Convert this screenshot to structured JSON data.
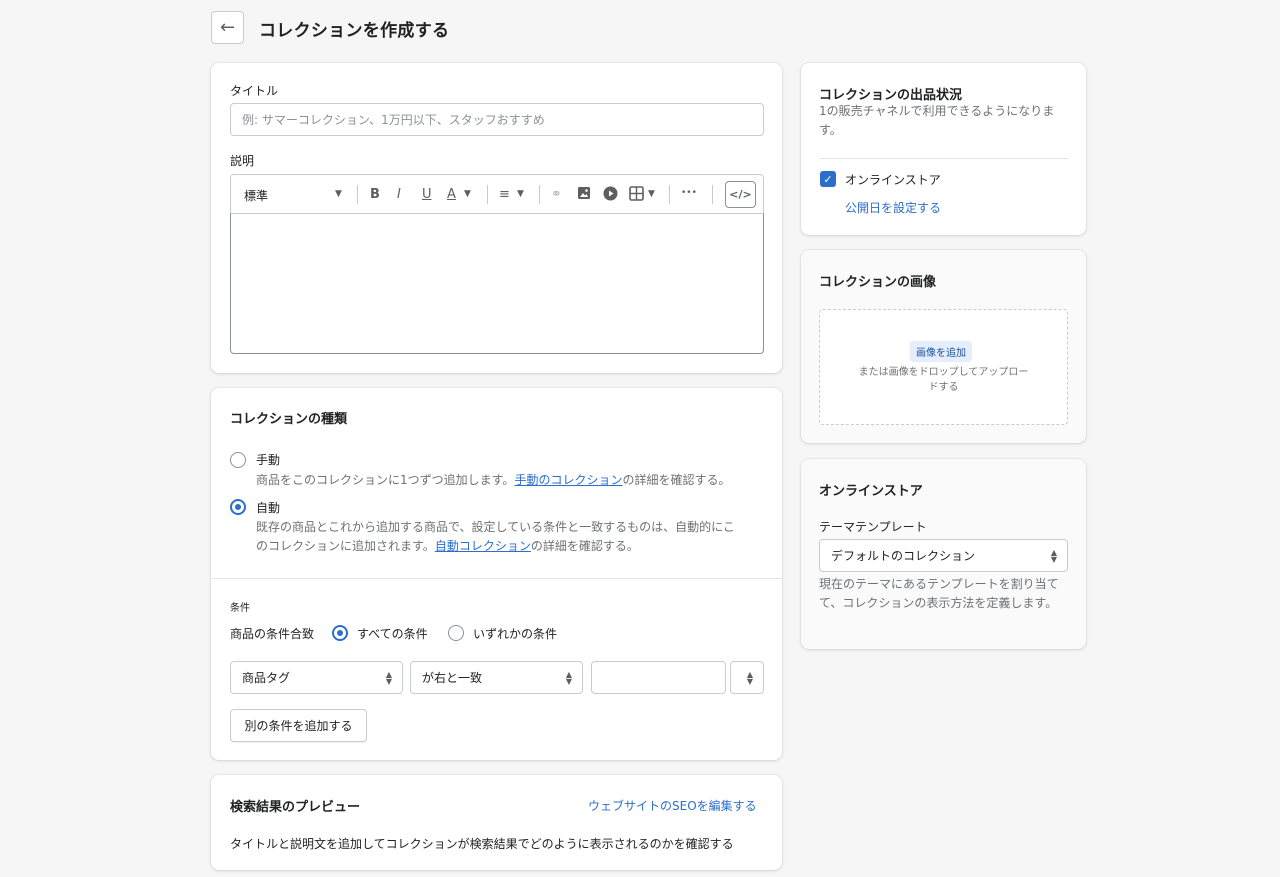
{
  "header": {
    "back_icon": "arrow-left-icon",
    "title": "コレクションを作成する"
  },
  "details": {
    "title_label": "タイトル",
    "title_placeholder": "例: サマーコレクション、1万円以下、スタッフおすすめ",
    "description_label": "説明",
    "toolbar": {
      "format_value": "標準",
      "bold": "B",
      "italic": "I",
      "underline": "U",
      "text_color": "A",
      "align_icon": "align-left-icon",
      "link_icon": "link-icon",
      "image_icon": "image-icon",
      "video_icon": "play-icon",
      "table_icon": "table-icon",
      "more": "•••",
      "code": "</>"
    }
  },
  "collection_type": {
    "title": "コレクションの種類",
    "manual": {
      "label": "手動",
      "desc_before": "商品をこのコレクションに1つずつ追加します。",
      "desc_link": "手動のコレクション",
      "desc_after": "の詳細を確認する。",
      "selected": false
    },
    "automatic": {
      "label": "自動",
      "desc_line1": "既存の商品とこれから追加する商品で、設定している条件と一致するものは、自動的にこ",
      "desc_line2_before": "のコレクションに追加されます。",
      "desc_link": "自動コレクション",
      "desc_after": "の詳細を確認する。",
      "selected": true
    }
  },
  "conditions": {
    "title": "条件",
    "match_label": "商品の条件合致",
    "all_label": "すべての条件",
    "any_label": "いずれかの条件",
    "field_value": "商品タグ",
    "operator_value": "が右と一致",
    "value_input": "",
    "add_button": "別の条件を追加する"
  },
  "seo": {
    "title": "検索結果のプレビュー",
    "edit_link": "ウェブサイトのSEOを編集する",
    "desc": "タイトルと説明文を追加してコレクションが検索結果でどのように表示されるのかを確認する"
  },
  "availability": {
    "title": "コレクションの出品状況",
    "desc": "1の販売チャネルで利用できるようになります。",
    "channel_label": "オンラインストア",
    "channel_checked": true,
    "schedule_link": "公開日を設定する"
  },
  "image": {
    "title": "コレクションの画像",
    "add_button": "画像を追加",
    "drop_text_line1": "または画像をドロップしてアップロー",
    "drop_text_line2": "ドする"
  },
  "online_store": {
    "title": "オンラインストア",
    "template_label": "テーマテンプレート",
    "template_value": "デフォルトのコレクション",
    "help": "現在のテーマにあるテンプレートを割り当てて、コレクションの表示方法を定義します。"
  },
  "colors": {
    "accent": "#2c6ecb",
    "background": "#f6f6f7",
    "border": "#c9cccf"
  }
}
